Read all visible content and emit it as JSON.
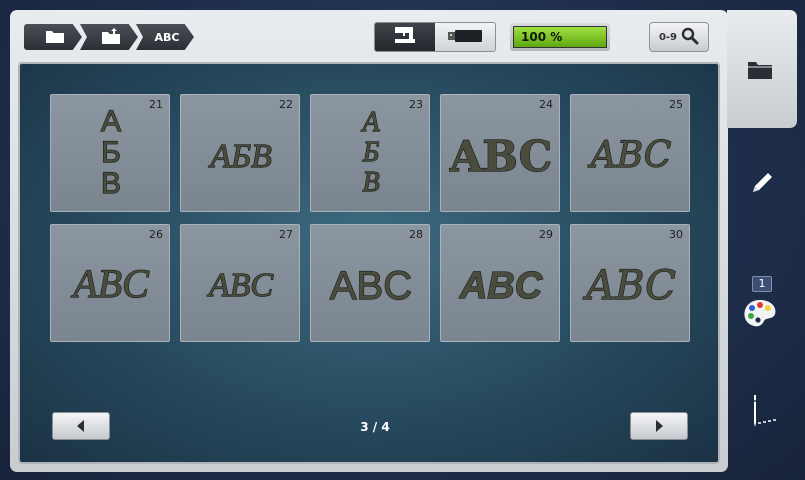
{
  "breadcrumb": {
    "items": [
      {
        "icon": "folder-icon",
        "label": ""
      },
      {
        "icon": "folder-upload-icon",
        "label": ""
      },
      {
        "icon": "",
        "label": "ABC"
      }
    ]
  },
  "view_toggle": {
    "options": [
      {
        "icon": "sewing-machine-icon",
        "active": true
      },
      {
        "icon": "usb-stick-icon",
        "active": false
      }
    ]
  },
  "memory": {
    "label": "100 %",
    "level_percent": 100
  },
  "search": {
    "label": "0-9",
    "icon": "magnifier-icon"
  },
  "fonts": {
    "tiles": [
      {
        "number": "21",
        "sample": "АБВ"
      },
      {
        "number": "22",
        "sample": "АБВ"
      },
      {
        "number": "23",
        "sample": "АБВ"
      },
      {
        "number": "24",
        "sample": "ABC"
      },
      {
        "number": "25",
        "sample": "ABC"
      },
      {
        "number": "26",
        "sample": "ABC"
      },
      {
        "number": "27",
        "sample": "ABC"
      },
      {
        "number": "28",
        "sample": "ABC"
      },
      {
        "number": "29",
        "sample": "ABC"
      },
      {
        "number": "30",
        "sample": "ABC"
      }
    ]
  },
  "pagination": {
    "label": "3 / 4",
    "prev_icon": "arrow-left-icon",
    "next_icon": "arrow-right-icon"
  },
  "sidebar": {
    "items": [
      {
        "icon": "folder-icon"
      },
      {
        "icon": "pencil-icon"
      },
      {
        "icon": "color-palette-icon",
        "badge": "1"
      },
      {
        "icon": "needle-icon"
      }
    ]
  },
  "colors": {
    "memory_fill": "#7cc828",
    "panel": "#2f5a6e",
    "tile": "#838e98"
  }
}
